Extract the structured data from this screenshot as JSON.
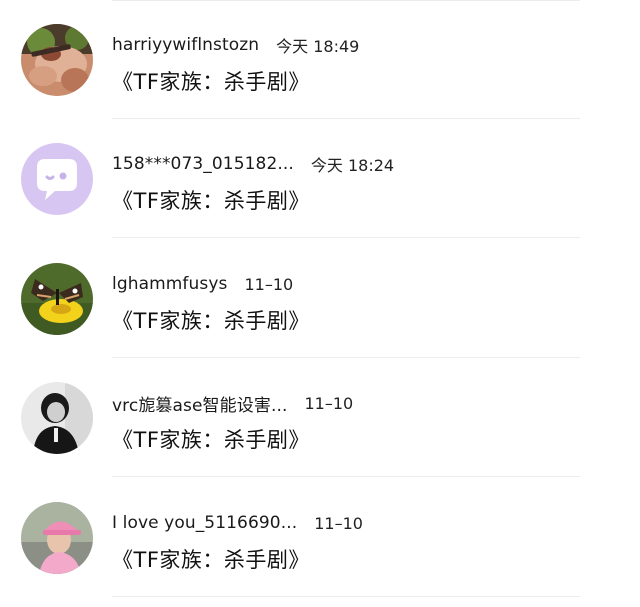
{
  "messages": [
    {
      "avatar_icon": "avatar-photo-hands",
      "name": "harriyywiflnstozn",
      "time": "今天 18:49",
      "title": "《TF家族：杀手剧》"
    },
    {
      "avatar_icon": "avatar-chat-bubble",
      "name": "158***073_015182...",
      "time": "今天 18:24",
      "title": "《TF家族：杀手剧》"
    },
    {
      "avatar_icon": "avatar-butterfly-flower",
      "name": "lghammfusys",
      "time": "11–10",
      "title": "《TF家族：杀手剧》"
    },
    {
      "avatar_icon": "avatar-person-dark",
      "name": "vrc旎篡ase智能设害...",
      "time": "11–10",
      "title": "《TF家族：杀手剧》"
    },
    {
      "avatar_icon": "avatar-person-pink-cap",
      "name": "I love you_5116690...",
      "time": "11–10",
      "title": "《TF家族：杀手剧》"
    }
  ],
  "colors": {
    "chat_bubble_bg": "#d8c6f2",
    "divider": "#ececec"
  }
}
